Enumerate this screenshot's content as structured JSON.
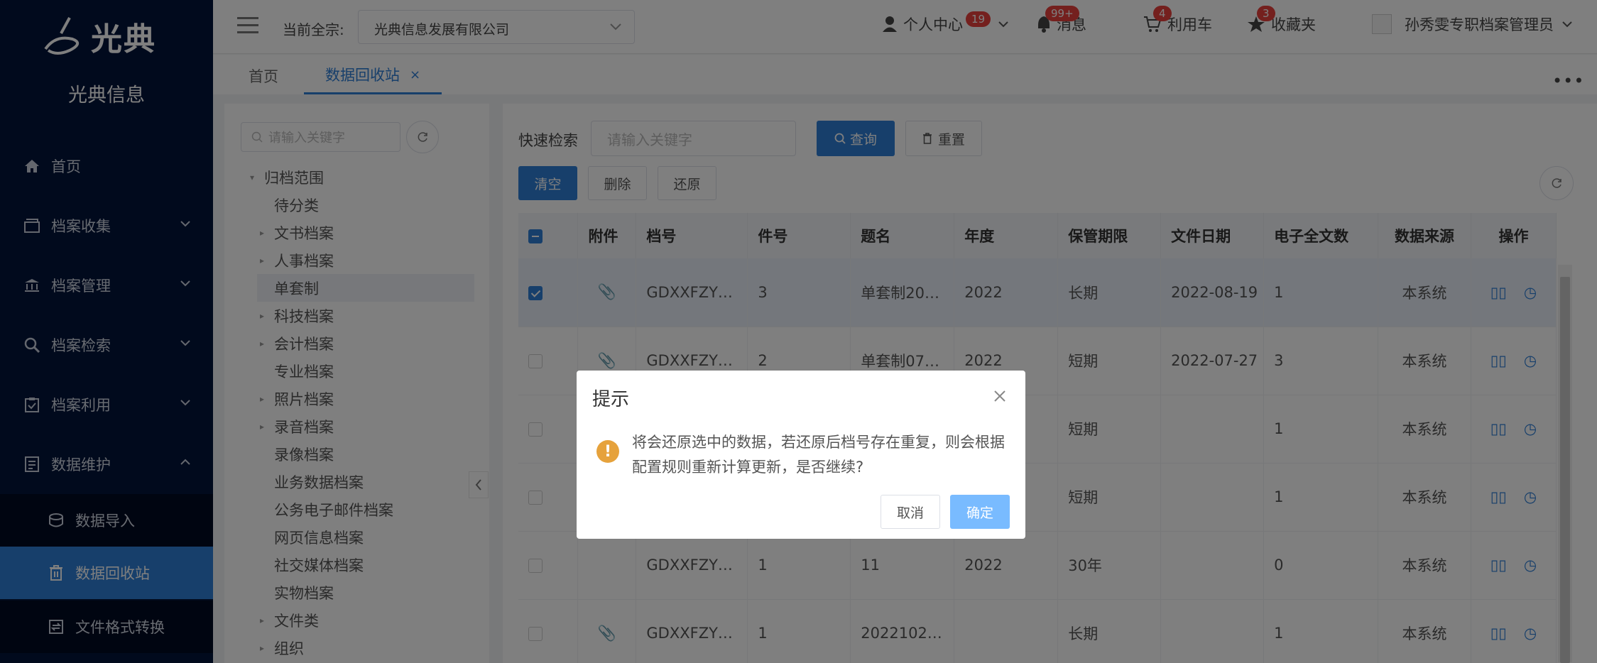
{
  "brand": {
    "logo_text": "光典",
    "company_name": "光典信息"
  },
  "sidebar": {
    "items": [
      {
        "label": "首页",
        "icon": "home-icon"
      },
      {
        "label": "档案收集",
        "icon": "box-icon"
      },
      {
        "label": "档案管理",
        "icon": "bank-icon"
      },
      {
        "label": "档案检索",
        "icon": "search-icon"
      },
      {
        "label": "档案利用",
        "icon": "clipboard-icon"
      },
      {
        "label": "数据维护",
        "icon": "database-icon"
      }
    ],
    "sub_items": [
      {
        "label": "数据导入",
        "icon": "import-icon"
      },
      {
        "label": "数据回收站",
        "icon": "trash-icon"
      },
      {
        "label": "文件格式转换",
        "icon": "convert-icon"
      }
    ]
  },
  "header": {
    "current_label": "当前全宗:",
    "company_value": "光典信息发展有限公司",
    "personal": "个人中心",
    "personal_badge": "19",
    "messages": "消息",
    "messages_badge": "99+",
    "cart": "利用车",
    "cart_badge": "4",
    "favorites": "收藏夹",
    "favorites_badge": "3",
    "user": "孙秀雯专职档案管理员"
  },
  "tabs": [
    {
      "label": "首页"
    },
    {
      "label": "数据回收站"
    }
  ],
  "tree": {
    "search_placeholder": "请输入关键字",
    "root": "归档范围",
    "items": [
      {
        "label": "待分类",
        "arrow": ""
      },
      {
        "label": "文书档案",
        "arrow": "▸"
      },
      {
        "label": "人事档案",
        "arrow": "▸"
      },
      {
        "label": "单套制",
        "arrow": ""
      },
      {
        "label": "科技档案",
        "arrow": "▸"
      },
      {
        "label": "会计档案",
        "arrow": "▸"
      },
      {
        "label": "专业档案",
        "arrow": ""
      },
      {
        "label": "照片档案",
        "arrow": "▸"
      },
      {
        "label": "录音档案",
        "arrow": "▸"
      },
      {
        "label": "录像档案",
        "arrow": ""
      },
      {
        "label": "业务数据档案",
        "arrow": ""
      },
      {
        "label": "公务电子邮件档案",
        "arrow": ""
      },
      {
        "label": "网页信息档案",
        "arrow": ""
      },
      {
        "label": "社交媒体档案",
        "arrow": ""
      },
      {
        "label": "实物档案",
        "arrow": ""
      },
      {
        "label": "文件类",
        "arrow": "▸"
      },
      {
        "label": "组织",
        "arrow": "▸"
      }
    ]
  },
  "toolbar": {
    "quick_search_label": "快速检索",
    "quick_search_placeholder": "请输入关键字",
    "query": "查询",
    "reset": "重置",
    "clear": "清空",
    "delete": "删除",
    "restore": "还原"
  },
  "table": {
    "columns": [
      "附件",
      "档号",
      "件号",
      "题名",
      "年度",
      "保管期限",
      "文件日期",
      "电子全文数",
      "数据来源",
      "操作"
    ],
    "rows": [
      {
        "checked": true,
        "attach": true,
        "dh": "GDXXFZY…",
        "jh": "3",
        "tm": "单套制20…",
        "nd": "2022",
        "qx": "长期",
        "rq": "2022-08-19",
        "dz": "1",
        "ly": "本系统"
      },
      {
        "checked": false,
        "attach": true,
        "dh": "GDXXFZY…",
        "jh": "2",
        "tm": "单套制07…",
        "nd": "2022",
        "qx": "短期",
        "rq": "2022-07-27",
        "dz": "3",
        "ly": "本系统"
      },
      {
        "checked": false,
        "attach": false,
        "dh": "",
        "jh": "",
        "tm": "",
        "nd": "",
        "qx": "短期",
        "rq": "",
        "dz": "1",
        "ly": "本系统"
      },
      {
        "checked": false,
        "attach": false,
        "dh": "",
        "jh": "",
        "tm": "",
        "nd": "",
        "qx": "短期",
        "rq": "",
        "dz": "1",
        "ly": "本系统"
      },
      {
        "checked": false,
        "attach": false,
        "dh": "GDXXFZY…",
        "jh": "1",
        "tm": "11",
        "nd": "2022",
        "qx": "30年",
        "rq": "",
        "dz": "0",
        "ly": "本系统"
      },
      {
        "checked": false,
        "attach": true,
        "dh": "GDXXFZY…",
        "jh": "1",
        "tm": "2022102…",
        "nd": "",
        "qx": "长期",
        "rq": "",
        "dz": "1",
        "ly": "本系统"
      }
    ]
  },
  "dialog": {
    "title": "提示",
    "message": "将会还原选中的数据，若还原后档号存在重复，则会根据配置规则重新计算更新，是否继续?",
    "cancel": "取消",
    "confirm": "确定"
  },
  "colors": {
    "sidebar_bg": "#03143a",
    "accent": "#2f7fd6",
    "warning": "#e6a23c",
    "badge": "#e8403d"
  }
}
